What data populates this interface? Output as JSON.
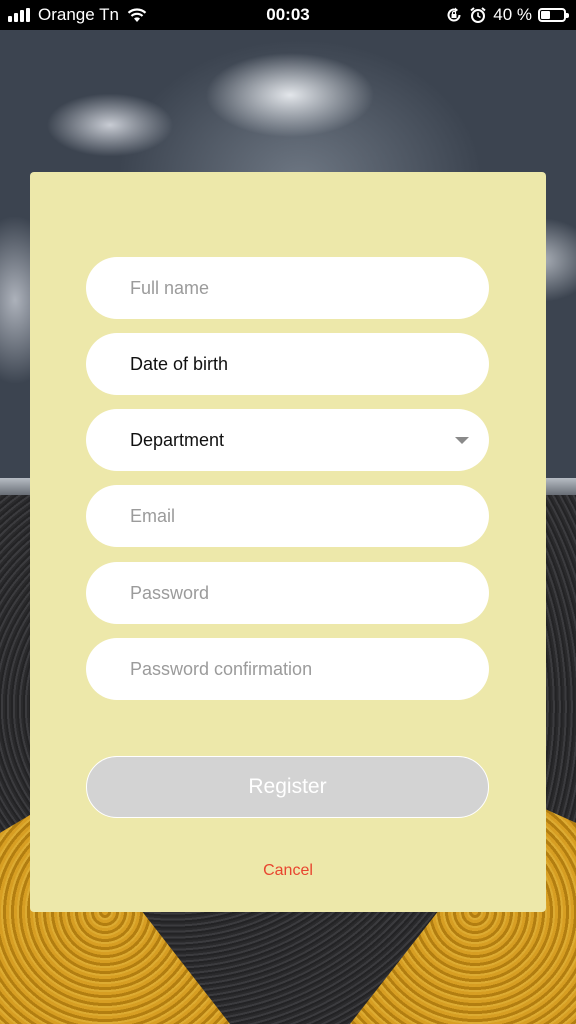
{
  "status_bar": {
    "carrier": "Orange Tn",
    "time": "00:03",
    "battery_percent": "40 %",
    "battery_level": 0.4
  },
  "form": {
    "full_name": {
      "placeholder": "Full name"
    },
    "date_of_birth": {
      "value": "Date of birth"
    },
    "department": {
      "value": "Department",
      "icon": "chevron-down-icon"
    },
    "email": {
      "placeholder": "Email"
    },
    "password": {
      "placeholder": "Password"
    },
    "password_confirmation": {
      "placeholder": "Password confirmation"
    },
    "register_label": "Register",
    "cancel_label": "Cancel"
  },
  "colors": {
    "card_background": "#ede8aa",
    "register_disabled": "#d3d3d3",
    "cancel_text": "#e8452f"
  }
}
